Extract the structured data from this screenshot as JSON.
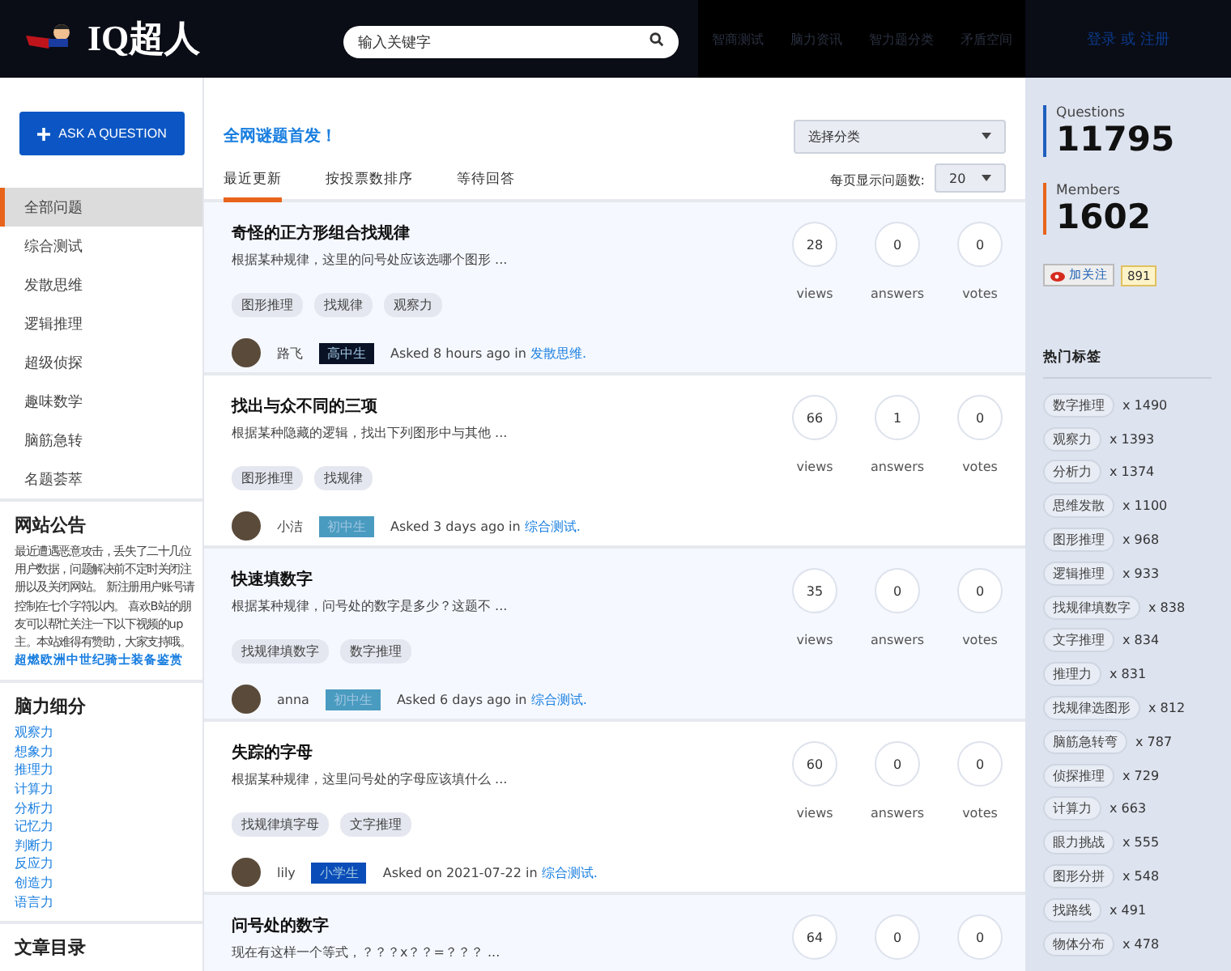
{
  "header": {
    "logo": "IQ超人",
    "search": {
      "placeholder": "输入关键字"
    },
    "nav": [
      "智商测试",
      "脑力资讯",
      "智力题分类",
      "矛盾空间"
    ],
    "login": "登录 或 注册"
  },
  "sidebar": {
    "ask_button": "ASK A QUESTION",
    "items": [
      {
        "label": "全部问题",
        "selected": true
      },
      {
        "label": "综合测试",
        "selected": false
      },
      {
        "label": "发散思维",
        "selected": false
      },
      {
        "label": "逻辑推理",
        "selected": false
      },
      {
        "label": "超级侦探",
        "selected": false
      },
      {
        "label": "趣味数学",
        "selected": false
      },
      {
        "label": "脑筋急转",
        "selected": false
      },
      {
        "label": "名题荟萃",
        "selected": false
      }
    ],
    "notice": {
      "title": "网站公告",
      "text": "最近遭遇恶意攻击，丢失了二十几位用户数据，问题解决前不定时关闭注册以及关闭网站。 新注册用户账号请控制在七个字符以内。 喜欢B站的朋友可以帮忙关注一下以下视频的up主。本站难得有赞助，大家支持哦。",
      "link": "超燃欧洲中世纪骑士装备鉴赏"
    },
    "brain": {
      "title": "脑力细分",
      "links": [
        "观察力",
        "想象力",
        "推理力",
        "计算力",
        "分析力",
        "记忆力",
        "判断力",
        "反应力",
        "创造力",
        "语言力"
      ]
    },
    "articles": {
      "title": "文章目录"
    }
  },
  "main": {
    "headline": "全网谜题首发！",
    "category_select": "选择分类",
    "tabs": [
      {
        "label": "最近更新",
        "selected": true
      },
      {
        "label": "按投票数排序",
        "selected": false
      },
      {
        "label": "等待回答",
        "selected": false
      }
    ],
    "per_page_label": "每页显示问题数:",
    "per_page": "20",
    "questions": [
      {
        "title": "奇怪的正方形组合找规律",
        "excerpt": "根据某种规律，这里的问号处应该选哪个图形 ...",
        "tags": [
          "图形推理",
          "找规律",
          "观察力"
        ],
        "user": "路飞",
        "badge": {
          "label": "高中生",
          "kind": "senior"
        },
        "asked": "Asked 8 hours ago in",
        "category": "发散思维.",
        "views": "28",
        "answers": "0",
        "votes": "0",
        "labels": [
          "views",
          "answers",
          "votes"
        ]
      },
      {
        "title": "找出与众不同的三项",
        "excerpt": "根据某种隐藏的逻辑，找出下列图形中与其他 ...",
        "tags": [
          "图形推理",
          "找规律"
        ],
        "user": "小洁",
        "badge": {
          "label": "初中生",
          "kind": "junior"
        },
        "asked": "Asked 3 days ago in",
        "category": "综合测试.",
        "views": "66",
        "answers": "1",
        "votes": "0",
        "labels": [
          "views",
          "answers",
          "votes"
        ]
      },
      {
        "title": "快速填数字",
        "excerpt": "根据某种规律，问号处的数字是多少？这题不 ...",
        "tags": [
          "找规律填数字",
          "数字推理"
        ],
        "user": "anna",
        "badge": {
          "label": "初中生",
          "kind": "junior"
        },
        "asked": "Asked 6 days ago in",
        "category": "综合测试.",
        "views": "35",
        "answers": "0",
        "votes": "0",
        "labels": [
          "views",
          "answers",
          "votes"
        ]
      },
      {
        "title": "失踪的字母",
        "excerpt": "根据某种规律，这里问号处的字母应该填什么 ...",
        "tags": [
          "找规律填字母",
          "文字推理"
        ],
        "user": "lily",
        "badge": {
          "label": "小学生",
          "kind": "primary"
        },
        "asked": "Asked on 2021-07-22 in",
        "category": "综合测试.",
        "views": "60",
        "answers": "0",
        "votes": "0",
        "labels": [
          "views",
          "answers",
          "votes"
        ]
      },
      {
        "title": "问号处的数字",
        "excerpt": "现在有这样一个等式，？？？x？？=？？？ ...",
        "views": "64",
        "answers": "0",
        "votes": "0"
      }
    ]
  },
  "right": {
    "stats": [
      {
        "label": "Questions",
        "value": "11795",
        "color": "#1f5fbf"
      },
      {
        "label": "Members",
        "value": "1602",
        "color": "#e8641b"
      }
    ],
    "follow": {
      "label": "加关注",
      "count": "891"
    },
    "hot_tags_title": "热门标签",
    "hot_tags": [
      {
        "tag": "数字推理",
        "count": "x 1490"
      },
      {
        "tag": "观察力",
        "count": "x 1393"
      },
      {
        "tag": "分析力",
        "count": "x 1374"
      },
      {
        "tag": "思维发散",
        "count": "x 1100"
      },
      {
        "tag": "图形推理",
        "count": "x 968"
      },
      {
        "tag": "逻辑推理",
        "count": "x 933"
      },
      {
        "tag": "找规律填数字",
        "count": "x 838"
      },
      {
        "tag": "文字推理",
        "count": "x 834"
      },
      {
        "tag": "推理力",
        "count": "x 831"
      },
      {
        "tag": "找规律选图形",
        "count": "x 812"
      },
      {
        "tag": "脑筋急转弯",
        "count": "x 787"
      },
      {
        "tag": "侦探推理",
        "count": "x 729"
      },
      {
        "tag": "计算力",
        "count": "x 663"
      },
      {
        "tag": "眼力挑战",
        "count": "x 555"
      },
      {
        "tag": "图形分拼",
        "count": "x 548"
      },
      {
        "tag": "找路线",
        "count": "x 491"
      },
      {
        "tag": "物体分布",
        "count": "x 478"
      }
    ]
  }
}
